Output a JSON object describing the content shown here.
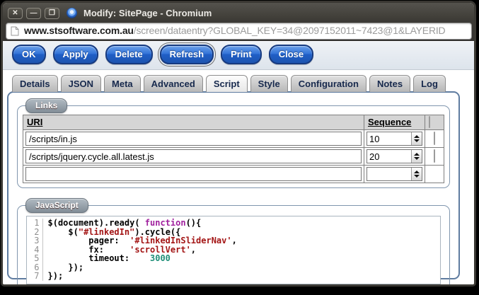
{
  "window": {
    "title": "Modify: SitePage - Chromium",
    "controls": [
      {
        "name": "close",
        "glyph": "✕"
      },
      {
        "name": "minimize",
        "glyph": "—"
      },
      {
        "name": "maximize",
        "glyph": "❒"
      }
    ]
  },
  "address_bar": {
    "host": "www.stsoftware.com.au",
    "path": "/screen/dataentry?GLOBAL_KEY=34@2097152011~7423@1&LAYERID"
  },
  "toolbar": {
    "buttons": [
      "OK",
      "Apply",
      "Delete",
      "Refresh",
      "Print",
      "Close"
    ],
    "focused_button": "Refresh"
  },
  "tabs": {
    "items": [
      "Details",
      "JSON",
      "Meta",
      "Advanced",
      "Script",
      "Style",
      "Configuration",
      "Notes",
      "Log"
    ],
    "active": "Script"
  },
  "links_section": {
    "legend": "Links",
    "columns": {
      "uri": "URI",
      "sequence": "Sequence"
    },
    "header_checkbox": true,
    "rows": [
      {
        "uri": "/scripts/in.js",
        "sequence": "10",
        "checkbox": true
      },
      {
        "uri": "/scripts/jquery.cycle.all.latest.js",
        "sequence": "20",
        "checkbox": true
      },
      {
        "uri": "",
        "sequence": "",
        "checkbox": false
      }
    ]
  },
  "javascript_section": {
    "legend": "JavaScript",
    "code_lines": [
      {
        "num": "1",
        "segments": [
          {
            "t": "$(document).ready( ",
            "c": "plain"
          },
          {
            "t": "function",
            "c": "keyword"
          },
          {
            "t": "(){",
            "c": "plain"
          }
        ]
      },
      {
        "num": "2",
        "segments": [
          {
            "t": "    $(",
            "c": "plain"
          },
          {
            "t": "\"#linkedIn\"",
            "c": "string"
          },
          {
            "t": ").cycle({",
            "c": "plain"
          }
        ]
      },
      {
        "num": "3",
        "segments": [
          {
            "t": "        pager:  ",
            "c": "plain"
          },
          {
            "t": "'#linkedInSliderNav'",
            "c": "string"
          },
          {
            "t": ",",
            "c": "plain"
          }
        ]
      },
      {
        "num": "4",
        "segments": [
          {
            "t": "        fx:     ",
            "c": "plain"
          },
          {
            "t": "'scrollVert'",
            "c": "string"
          },
          {
            "t": ",",
            "c": "plain"
          }
        ]
      },
      {
        "num": "5",
        "segments": [
          {
            "t": "        timeout:    ",
            "c": "plain"
          },
          {
            "t": "3000",
            "c": "number"
          }
        ]
      },
      {
        "num": "6",
        "segments": [
          {
            "t": "    });",
            "c": "plain"
          }
        ]
      },
      {
        "num": "7",
        "segments": [
          {
            "t": "});",
            "c": "plain"
          }
        ]
      }
    ]
  },
  "colors": {
    "button_border": "#163a80",
    "panel_border": "#5f7ca0",
    "code_keyword": "#a0219e",
    "code_string": "#a31515",
    "code_number": "#1f8f78"
  }
}
